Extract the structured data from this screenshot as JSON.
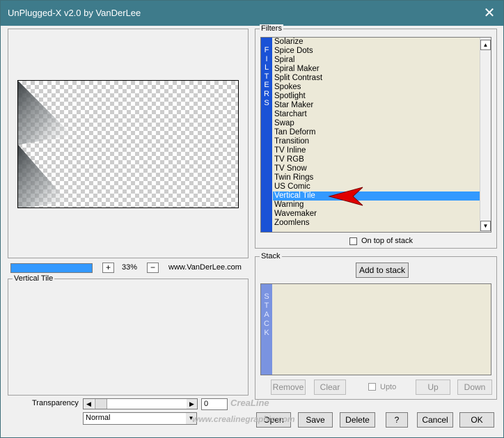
{
  "window": {
    "title": "UnPlugged-X v2.0 by VanDerLee",
    "close_symbol": "✕"
  },
  "preview": {
    "zoom_value": "33%",
    "zoom_in": "+",
    "zoom_out": "−",
    "site_label": "www.VanDerLee.com",
    "progress_fraction": 1.0
  },
  "info": {
    "caption": "Vertical Tile"
  },
  "transparency": {
    "label": "Transparency",
    "value": "0",
    "scroll_left": "◀",
    "scroll_right": "▶"
  },
  "blend_mode": {
    "selected": "Normal",
    "dropdown_symbol": "▼"
  },
  "filters": {
    "caption": "Filters",
    "strip_label": "F I L T E R S",
    "items": [
      "Solarize",
      "Spice Dots",
      "Spiral",
      "Spiral Maker",
      "Split Contrast",
      "Spokes",
      "Spotlight",
      "Star Maker",
      "Starchart",
      "Swap",
      "Tan Deform",
      "Transition",
      "TV Inline",
      "TV RGB",
      "TV Snow",
      "Twin Rings",
      "US Comic",
      "Vertical Tile",
      "Warning",
      "Wavemaker",
      "Zoomlens"
    ],
    "selected": "Vertical Tile",
    "scroll_up": "▲",
    "scroll_down": "▼",
    "on_top_label": "On top of stack"
  },
  "stack": {
    "caption": "Stack",
    "add_button": "Add to stack",
    "strip_label": "S T A C K",
    "remove": "Remove",
    "clear": "Clear",
    "upto": "Upto",
    "up": "Up",
    "down": "Down"
  },
  "footer": {
    "open": "Open",
    "save": "Save",
    "delete": "Delete",
    "help": "?",
    "cancel": "Cancel",
    "ok": "OK"
  },
  "watermark": {
    "line1": "CreaLine",
    "line2": "www.crealinegraphic.com"
  },
  "colors": {
    "titlebar": "#3e7b8b",
    "filter_strip": "#1a52d6",
    "selection": "#3399ff",
    "list_bg": "#ece9d8",
    "arrow": "#e00000"
  }
}
